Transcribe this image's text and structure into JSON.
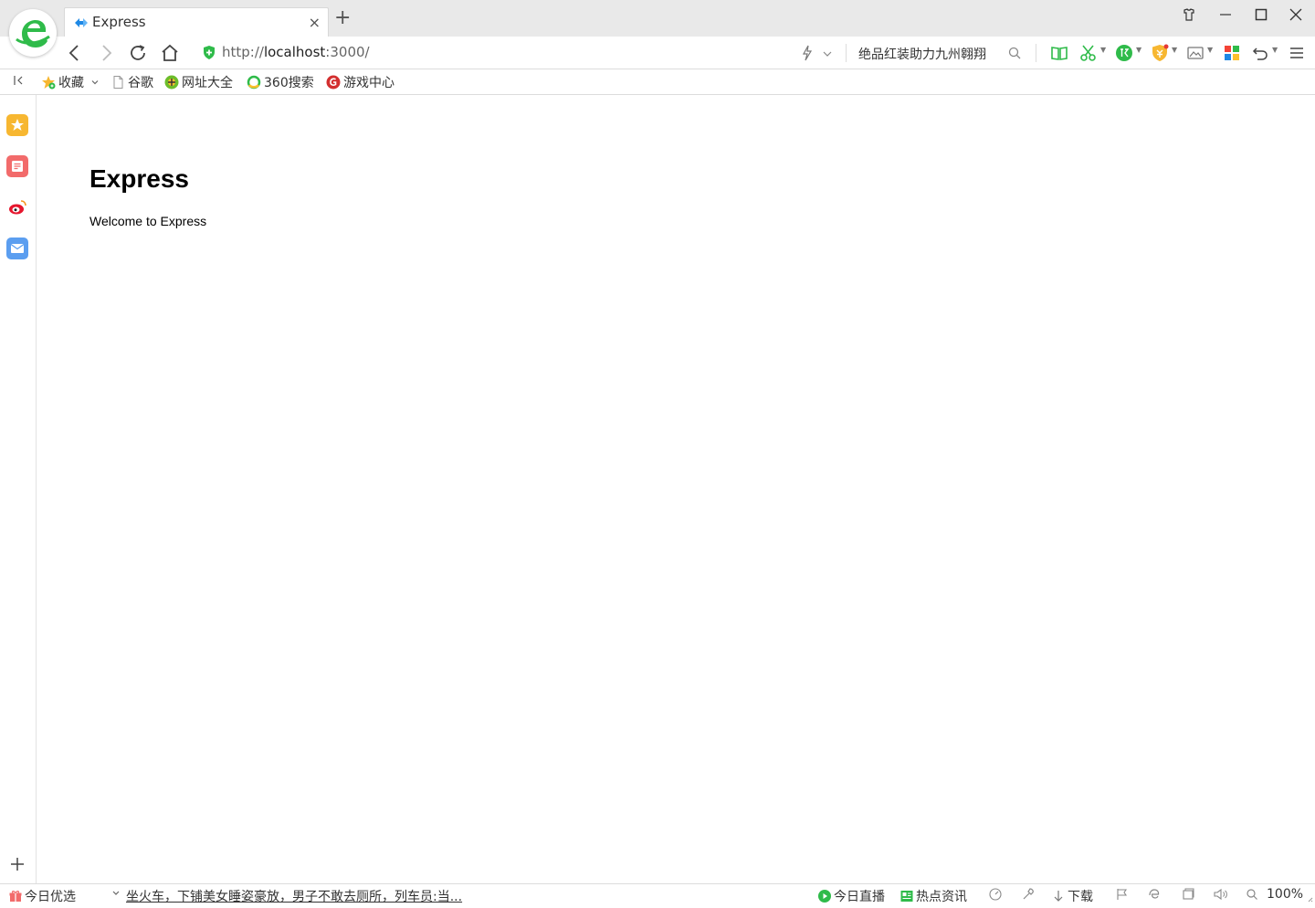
{
  "browser": {
    "tab": {
      "title": "Express",
      "close_glyph": "×"
    },
    "new_tab_glyph": "+",
    "address": {
      "scheme": "http://",
      "host": "localhost",
      "rest": ":3000/"
    },
    "search": {
      "text": "绝品红装助力九州翱翔"
    }
  },
  "bookmarks": {
    "favorites": "收藏",
    "items": [
      "谷歌",
      "网址大全",
      "360搜索",
      "游戏中心"
    ]
  },
  "page": {
    "heading": "Express",
    "text": "Welcome to Express"
  },
  "statusbar": {
    "daily_pick": "今日优选",
    "news": "坐火车，下铺美女睡姿豪放，男子不敢去厕所，列车员:当...",
    "live": "今日直播",
    "hot_news": "热点资讯",
    "download": "下载",
    "zoom": "100%"
  },
  "colors": {
    "brand_green": "#2fbb4a",
    "shield_green": "#2fbb4a",
    "sidebar_favorites": "#f7b731",
    "sidebar_news": "#f26b6b",
    "sidebar_weibo": "#e6162d",
    "sidebar_mail": "#5b9ef0"
  }
}
